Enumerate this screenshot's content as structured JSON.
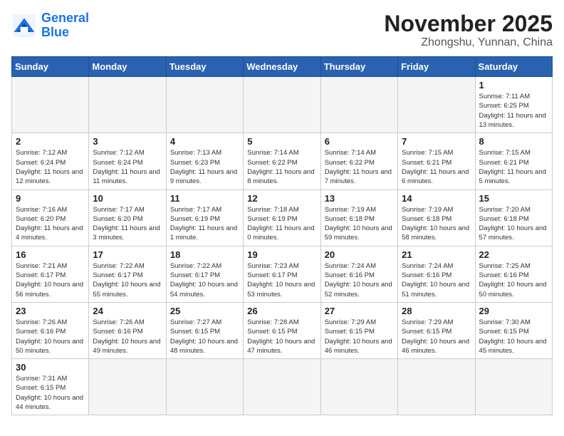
{
  "logo": {
    "line1": "General",
    "line2": "Blue"
  },
  "title": "November 2025",
  "subtitle": "Zhongshu, Yunnan, China",
  "days_of_week": [
    "Sunday",
    "Monday",
    "Tuesday",
    "Wednesday",
    "Thursday",
    "Friday",
    "Saturday"
  ],
  "weeks": [
    [
      {
        "day": "",
        "empty": true
      },
      {
        "day": "",
        "empty": true
      },
      {
        "day": "",
        "empty": true
      },
      {
        "day": "",
        "empty": true
      },
      {
        "day": "",
        "empty": true
      },
      {
        "day": "",
        "empty": true
      },
      {
        "day": "1",
        "sunrise": "7:11 AM",
        "sunset": "6:25 PM",
        "daylight": "11 hours and 13 minutes."
      }
    ],
    [
      {
        "day": "2",
        "sunrise": "7:12 AM",
        "sunset": "6:24 PM",
        "daylight": "11 hours and 12 minutes."
      },
      {
        "day": "3",
        "sunrise": "7:12 AM",
        "sunset": "6:24 PM",
        "daylight": "11 hours and 11 minutes."
      },
      {
        "day": "4",
        "sunrise": "7:13 AM",
        "sunset": "6:23 PM",
        "daylight": "11 hours and 9 minutes."
      },
      {
        "day": "5",
        "sunrise": "7:14 AM",
        "sunset": "6:22 PM",
        "daylight": "11 hours and 8 minutes."
      },
      {
        "day": "6",
        "sunrise": "7:14 AM",
        "sunset": "6:22 PM",
        "daylight": "11 hours and 7 minutes."
      },
      {
        "day": "7",
        "sunrise": "7:15 AM",
        "sunset": "6:21 PM",
        "daylight": "11 hours and 6 minutes."
      },
      {
        "day": "8",
        "sunrise": "7:15 AM",
        "sunset": "6:21 PM",
        "daylight": "11 hours and 5 minutes."
      }
    ],
    [
      {
        "day": "9",
        "sunrise": "7:16 AM",
        "sunset": "6:20 PM",
        "daylight": "11 hours and 4 minutes."
      },
      {
        "day": "10",
        "sunrise": "7:17 AM",
        "sunset": "6:20 PM",
        "daylight": "11 hours and 3 minutes."
      },
      {
        "day": "11",
        "sunrise": "7:17 AM",
        "sunset": "6:19 PM",
        "daylight": "11 hours and 1 minute."
      },
      {
        "day": "12",
        "sunrise": "7:18 AM",
        "sunset": "6:19 PM",
        "daylight": "11 hours and 0 minutes."
      },
      {
        "day": "13",
        "sunrise": "7:19 AM",
        "sunset": "6:18 PM",
        "daylight": "10 hours and 59 minutes."
      },
      {
        "day": "14",
        "sunrise": "7:19 AM",
        "sunset": "6:18 PM",
        "daylight": "10 hours and 58 minutes."
      },
      {
        "day": "15",
        "sunrise": "7:20 AM",
        "sunset": "6:18 PM",
        "daylight": "10 hours and 57 minutes."
      }
    ],
    [
      {
        "day": "16",
        "sunrise": "7:21 AM",
        "sunset": "6:17 PM",
        "daylight": "10 hours and 56 minutes."
      },
      {
        "day": "17",
        "sunrise": "7:22 AM",
        "sunset": "6:17 PM",
        "daylight": "10 hours and 55 minutes."
      },
      {
        "day": "18",
        "sunrise": "7:22 AM",
        "sunset": "6:17 PM",
        "daylight": "10 hours and 54 minutes."
      },
      {
        "day": "19",
        "sunrise": "7:23 AM",
        "sunset": "6:17 PM",
        "daylight": "10 hours and 53 minutes."
      },
      {
        "day": "20",
        "sunrise": "7:24 AM",
        "sunset": "6:16 PM",
        "daylight": "10 hours and 52 minutes."
      },
      {
        "day": "21",
        "sunrise": "7:24 AM",
        "sunset": "6:16 PM",
        "daylight": "10 hours and 51 minutes."
      },
      {
        "day": "22",
        "sunrise": "7:25 AM",
        "sunset": "6:16 PM",
        "daylight": "10 hours and 50 minutes."
      }
    ],
    [
      {
        "day": "23",
        "sunrise": "7:26 AM",
        "sunset": "6:16 PM",
        "daylight": "10 hours and 50 minutes."
      },
      {
        "day": "24",
        "sunrise": "7:26 AM",
        "sunset": "6:16 PM",
        "daylight": "10 hours and 49 minutes."
      },
      {
        "day": "25",
        "sunrise": "7:27 AM",
        "sunset": "6:15 PM",
        "daylight": "10 hours and 48 minutes."
      },
      {
        "day": "26",
        "sunrise": "7:28 AM",
        "sunset": "6:15 PM",
        "daylight": "10 hours and 47 minutes."
      },
      {
        "day": "27",
        "sunrise": "7:29 AM",
        "sunset": "6:15 PM",
        "daylight": "10 hours and 46 minutes."
      },
      {
        "day": "28",
        "sunrise": "7:29 AM",
        "sunset": "6:15 PM",
        "daylight": "10 hours and 46 minutes."
      },
      {
        "day": "29",
        "sunrise": "7:30 AM",
        "sunset": "6:15 PM",
        "daylight": "10 hours and 45 minutes."
      }
    ],
    [
      {
        "day": "30",
        "sunrise": "7:31 AM",
        "sunset": "6:15 PM",
        "daylight": "10 hours and 44 minutes."
      },
      {
        "day": "",
        "empty": true
      },
      {
        "day": "",
        "empty": true
      },
      {
        "day": "",
        "empty": true
      },
      {
        "day": "",
        "empty": true
      },
      {
        "day": "",
        "empty": true
      },
      {
        "day": "",
        "empty": true
      }
    ]
  ]
}
